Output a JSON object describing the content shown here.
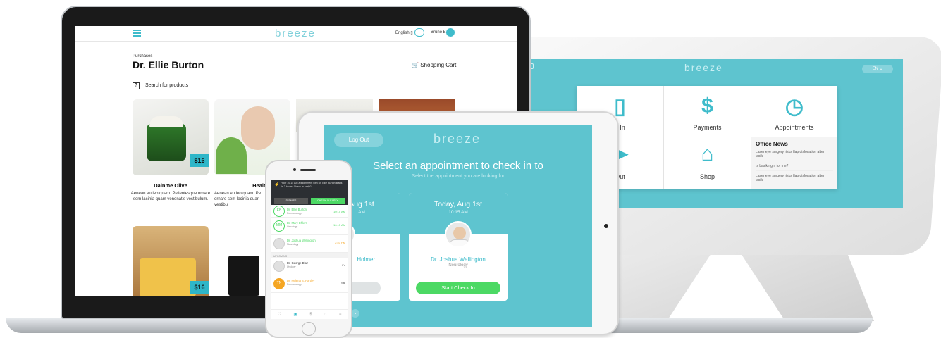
{
  "laptop": {
    "logo": "breeze",
    "language": "English",
    "user": "Bruno B.",
    "breadcrumb": "Purchases",
    "page_title": "Dr. Ellie Burton",
    "cart_label": "Shopping Cart",
    "search_placeholder": "Search for products",
    "products": [
      {
        "name": "Dainme Olive",
        "price": "$16",
        "desc": "Aenean eu leo quam. Pellentesque ornare sem lacinia quam venenatis vestibulum."
      },
      {
        "name": "Healthy Crea",
        "price": "",
        "desc": "Aenean eu leo quam. Pe ornare sem lacinia quar vestibul"
      },
      {
        "name": "",
        "price": "$16",
        "desc": ""
      }
    ]
  },
  "kiosk": {
    "logo": "breeze",
    "lang_button": "EN",
    "tiles": [
      {
        "label": "k In",
        "icon": "checkin-icon"
      },
      {
        "label": "Payments",
        "icon": "dollar-icon"
      },
      {
        "label": "Appointments",
        "icon": "clock-icon"
      },
      {
        "label": "Out",
        "icon": "checkout-icon"
      },
      {
        "label": "Shop",
        "icon": "basket-icon"
      }
    ],
    "news": {
      "title": "Office News",
      "items": [
        "Laser eye surgery risks flap dislocation after lasik.",
        "Is Lasik right for me?",
        "Laser eye surgery risks flap dislocation after lasik."
      ]
    }
  },
  "tablet": {
    "logout": "Log Out",
    "logo": "breeze",
    "heading": "Select an appointment to check in to",
    "subheading": "Select the appointment you are looking for",
    "appointments": [
      {
        "date": "Aug 1st",
        "time": "AM",
        "doctor": ". Holmer",
        "specialty": "ology",
        "button": "ut"
      },
      {
        "date": "Today, Aug 1st",
        "time": "10:15 AM",
        "doctor": "Dr. Joshua Wellington",
        "specialty": "Neurology",
        "button": "Start Check In"
      }
    ]
  },
  "phone": {
    "banner_text": "Your 10:15 AM appointment with Dr. Ellie Burton starts in 2 hours. Check in early?",
    "dismiss": "DISMISS",
    "check_in_early": "CHECK IN EARLY",
    "rows": [
      {
        "initials": "EB",
        "name": "Dr. Ellie Burton",
        "spec": "Pulmonology",
        "time": "10:15 AM",
        "color": "#4cd964"
      },
      {
        "initials": "MM",
        "name": "Dr. Mary Ehlers",
        "spec": "Oncology",
        "time": "10:15 AM",
        "color": "#4cd964"
      },
      {
        "initials": "",
        "name": "Dr. Joshua Wellington",
        "spec": "Neurology",
        "time": "2:40 PM",
        "color": "#4cd964"
      },
      {
        "initials": "",
        "name": "Dr. George Diaz",
        "spec": "Urology",
        "time": "Fri",
        "color": "#333333"
      },
      {
        "initials": "TN",
        "name": "Dr. Helena S. Hartley",
        "spec": "Pulmonology",
        "time": "Sat",
        "color": "#f5a623"
      }
    ],
    "upcoming_label": "UPCOMING"
  },
  "colors": {
    "teal": "#5ec4cf",
    "accent": "#3fbccb",
    "green": "#4cd964",
    "orange": "#f5a623"
  }
}
